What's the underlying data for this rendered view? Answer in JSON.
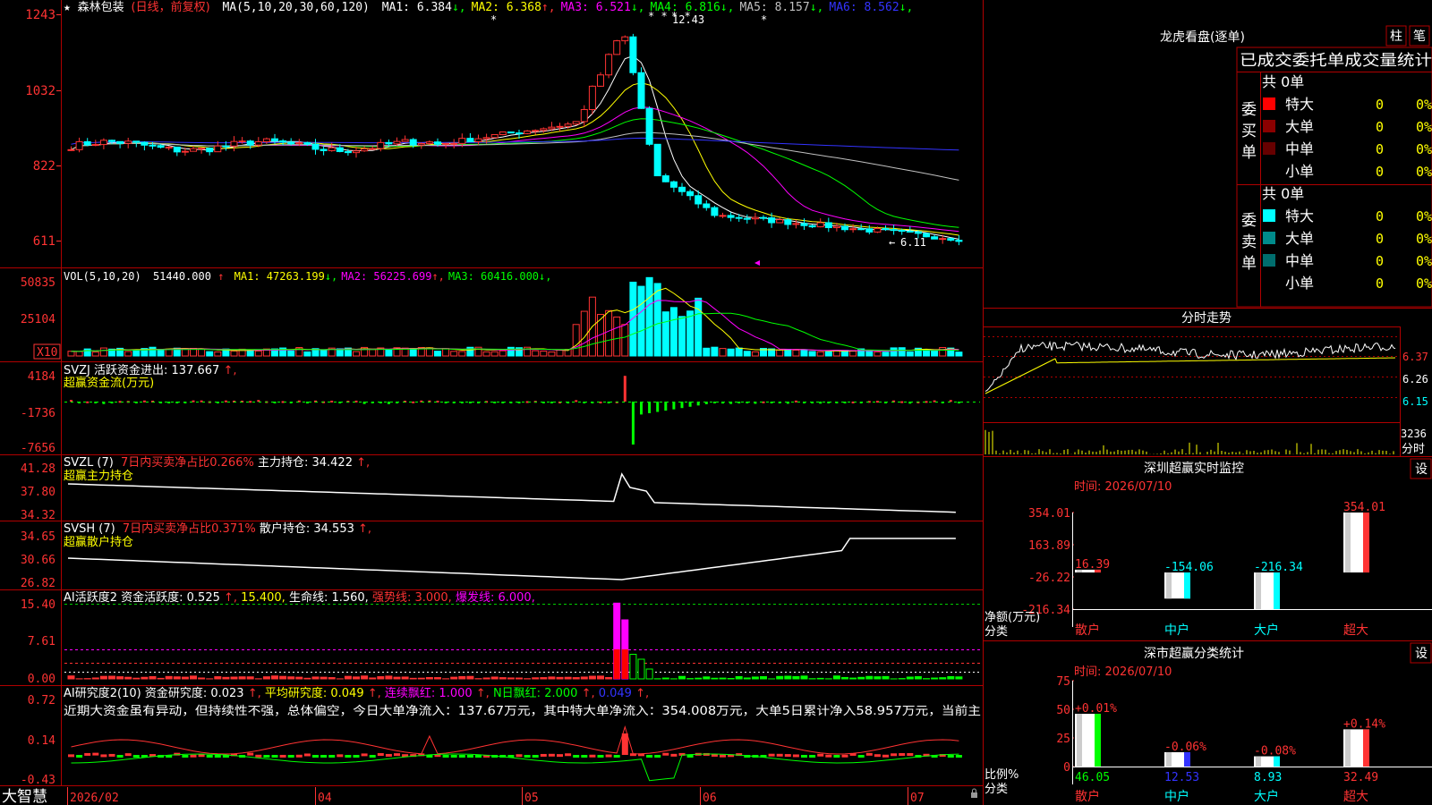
{
  "header": {
    "star": "★",
    "stock_name": "森林包装",
    "period": "(日线，前复权)",
    "ma_params": "MA(5,10,20,30,60,120)",
    "ma_values": [
      {
        "label": "MA1:",
        "value": "6.384",
        "arrow": "↓",
        "color": "#ffffff"
      },
      {
        "label": "MA2:",
        "value": "6.368",
        "arrow": "↑",
        "color": "#ffff00"
      },
      {
        "label": "MA3:",
        "value": "6.521",
        "arrow": "↓",
        "color": "#ff00ff"
      },
      {
        "label": "MA4:",
        "value": "6.816",
        "arrow": "↓",
        "color": "#00ff00"
      },
      {
        "label": "MA5:",
        "value": "8.157",
        "arrow": "↓",
        "color": "#c0c0c0"
      },
      {
        "label": "MA6:",
        "value": "8.562",
        "arrow": "↓",
        "color": "#3333ff"
      }
    ]
  },
  "price_panel": {
    "y_ticks": [
      "1243",
      "1032",
      "822",
      "611"
    ],
    "high_label": "12.43",
    "low_label": "6.11",
    "marks": [
      "*",
      "*",
      "* *",
      "* *"
    ]
  },
  "vol_panel": {
    "title": "VOL(5,10,20)",
    "value": "51440.000",
    "value_arrow": "↑",
    "ma": [
      {
        "label": "MA1:",
        "value": "47263.199",
        "arrow": "↓",
        "color": "#ffff00"
      },
      {
        "label": "MA2:",
        "value": "56225.699",
        "arrow": "↑",
        "color": "#ff00ff"
      },
      {
        "label": "MA3:",
        "value": "60416.000",
        "arrow": "↓",
        "color": "#00ff00"
      }
    ],
    "y_ticks": [
      "50835",
      "25104"
    ],
    "unit": "X10"
  },
  "svzj_panel": {
    "line1": "SVZJ  活跃资金进出: 137.667",
    "arrow": "↑,",
    "line2": "超赢资金流(万元)",
    "y_ticks": [
      "4184",
      "-1736",
      "-7656"
    ]
  },
  "svzl_panel": {
    "prefix": "SVZL (7)",
    "red_text": "7日内买卖净占比0.266%",
    "white_text": " 主力持仓: 34.422",
    "arrow": "↑,",
    "line2": "超赢主力持仓",
    "y_ticks": [
      "41.28",
      "37.80",
      "34.32"
    ]
  },
  "svsh_panel": {
    "prefix": "SVSH (7)",
    "red_text": "7日内买卖净占比0.371%",
    "white_text": " 散户持仓: 34.553",
    "arrow": "↑,",
    "line2": "超赢散户持仓",
    "y_ticks": [
      "34.65",
      "30.66",
      "26.82"
    ]
  },
  "ai_active_panel": {
    "title": "AI活跃度2 资金活跃度: 0.525",
    "arrow": "↑,",
    "v2": "15.400,",
    "v3": " 生命线: 1.560,",
    "v4": " 强势线: 3.000,",
    "v5": " 爆发线: 6.000,",
    "y_ticks": [
      "15.40",
      "7.61",
      "0.00"
    ]
  },
  "ai_research_panel": {
    "title": "AI研究度2(10) 资金研究度: 0.023",
    "a1": "↑,",
    "t2": " 平均研究度: 0.049",
    "a2": "↑,",
    "t3": " 连续飘红: 1.000",
    "a3": "↑,",
    "t4": " N日飘红: 2.000",
    "a4": "↑,",
    "t5": " 0.049",
    "a5": "↑,",
    "comment": "近期大资金虽有异动，但持续性不强，总体偏空，今日大单净流入：137.67万元，其中特大单净流入：354.008万元，大单5日累计净入58.957万元，当前主",
    "y_ticks": [
      "0.72",
      "0.14",
      "-0.43"
    ]
  },
  "x_axis": {
    "logo": "大智慧",
    "labels": [
      "2026/02",
      "04",
      "05",
      "06",
      "07"
    ]
  },
  "right_panel": {
    "lhb_title": "龙虎看盘(逐单)",
    "btn1": "柱",
    "btn2": "笔",
    "stat_title": "已成交委托单成交量统计",
    "buy_side": "委买单",
    "sell_side": "委卖单",
    "buy_total": "共 0单",
    "sell_total": "共 0单",
    "buy_rows": [
      {
        "label": "特大",
        "count": "0",
        "pct": "0%",
        "color": "#ff0000"
      },
      {
        "label": "大单",
        "count": "0",
        "pct": "0%",
        "color": "#8b0000"
      },
      {
        "label": "中单",
        "count": "0",
        "pct": "0%",
        "color": "#660000"
      },
      {
        "label": "小单",
        "count": "0",
        "pct": "0%",
        "color": ""
      }
    ],
    "sell_rows": [
      {
        "label": "特大",
        "count": "0",
        "pct": "0%",
        "color": "#00ffff"
      },
      {
        "label": "大单",
        "count": "0",
        "pct": "0%",
        "color": "#008b8b"
      },
      {
        "label": "中单",
        "count": "0",
        "pct": "0%",
        "color": "#006d6d"
      },
      {
        "label": "小单",
        "count": "0",
        "pct": "0%",
        "color": ""
      }
    ],
    "intraday_title": "分时走势",
    "intraday_ticks": [
      "6.37",
      "6.26",
      "6.15"
    ],
    "intraday_vol": "3236",
    "intraday_unit": "分时",
    "monitor_title": "深圳超赢实时监控",
    "monitor_btn": "设",
    "monitor_time": "时间: 2026/07/10",
    "monitor_unit": "净额(万元)",
    "monitor_cat": "分类",
    "classify_title": "深市超赢分类统计",
    "classify_btn": "设",
    "classify_time": "时间: 2026/07/10",
    "classify_unit": "比例%",
    "classify_cat": "分类"
  },
  "chart_data": [
    {
      "type": "bar",
      "title": "深圳超赢实时监控",
      "categories": [
        "散户",
        "中户",
        "大户",
        "超大"
      ],
      "values": [
        16.39,
        -154.06,
        -216.34,
        354.01
      ],
      "value_labels": [
        "16.39",
        "-154.06",
        "-216.34",
        "354.01"
      ],
      "y_ticks": [
        "354.01",
        "163.89",
        "-26.22",
        "-216.34"
      ],
      "ylim": [
        -216.34,
        354.01
      ],
      "ylabel": "净额(万元)",
      "xlabel": "分类",
      "colors": [
        "#ff3333",
        "#00ffff",
        "#00ffff",
        "#ff3333"
      ]
    },
    {
      "type": "bar",
      "title": "深市超赢分类统计",
      "categories": [
        "散户",
        "中户",
        "大户",
        "超大"
      ],
      "values": [
        46.05,
        12.53,
        8.93,
        32.49
      ],
      "value_labels": [
        "46.05",
        "12.53",
        "8.93",
        "32.49"
      ],
      "change_labels": [
        "+0.01%",
        "-0.06%",
        "-0.08%",
        "+0.14%"
      ],
      "y_ticks": [
        "75",
        "50",
        "25",
        "0"
      ],
      "ylim": [
        0,
        75
      ],
      "ylabel": "比例%",
      "xlabel": "分类",
      "colors": [
        "#00ff00",
        "#3333ff",
        "#00ffff",
        "#ff3333"
      ]
    }
  ],
  "colors": {
    "up": "#ff3333",
    "down": "#00ffff",
    "frame": "#b00000",
    "axis_text": "#ff3333",
    "highlight": "#ffff00"
  }
}
